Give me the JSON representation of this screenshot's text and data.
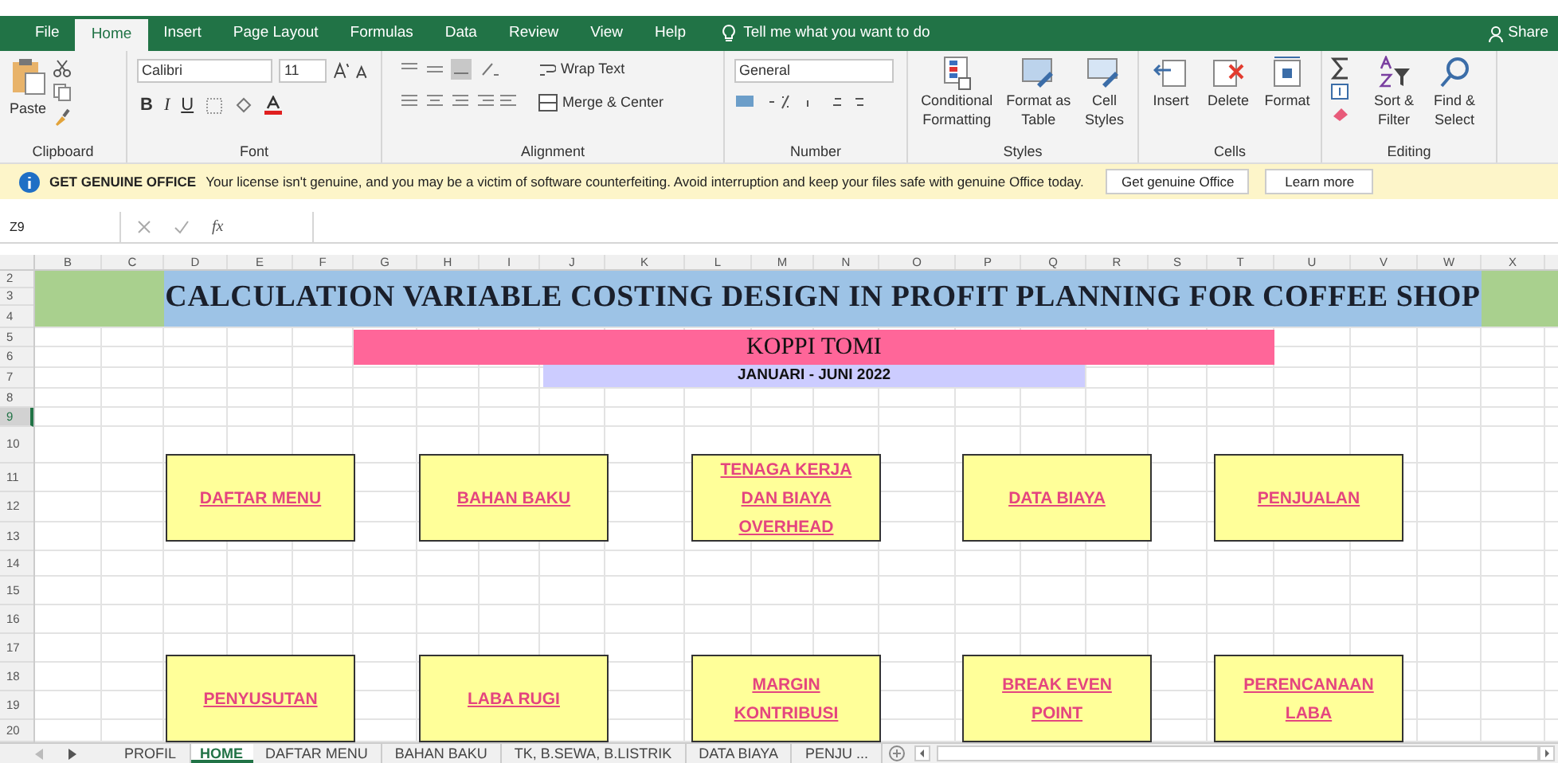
{
  "ribbon_tabs": [
    {
      "label": "File",
      "selected": false
    },
    {
      "label": "Home",
      "selected": true
    },
    {
      "label": "Insert",
      "selected": false
    },
    {
      "label": "Page Layout",
      "selected": false
    },
    {
      "label": "Formulas",
      "selected": false
    },
    {
      "label": "Data",
      "selected": false
    },
    {
      "label": "Review",
      "selected": false
    },
    {
      "label": "View",
      "selected": false
    },
    {
      "label": "Help",
      "selected": false
    }
  ],
  "tell_me": "Tell me what you want to do",
  "share": "Share",
  "ribbon": {
    "paste": "Paste",
    "font_name": "Calibri",
    "font_size": "11",
    "bold": "B",
    "italic": "I",
    "underline": "U",
    "wrap_text": "Wrap Text",
    "merge_center": "Merge & Center",
    "number_format": "General",
    "conditional_formatting": "Conditional Formatting",
    "format_as_table": "Format as Table",
    "cell_styles": "Cell Styles",
    "insert": "Insert",
    "delete": "Delete",
    "format": "Format",
    "sort_filter": "Sort & Filter",
    "find_select": "Find & Select",
    "groups": [
      "Clipboard",
      "Font",
      "Alignment",
      "Number",
      "Styles",
      "Cells",
      "Editing"
    ]
  },
  "notice": {
    "title": "GET GENUINE OFFICE",
    "message": "Your license isn't genuine, and you may be a victim of software counterfeiting. Avoid interruption and keep your files safe with genuine Office today.",
    "buttons": [
      "Get genuine Office",
      "Learn more"
    ]
  },
  "name_box": "Z9",
  "fx": "fx",
  "columns": [
    "B",
    "C",
    "D",
    "E",
    "F",
    "G",
    "H",
    "I",
    "J",
    "K",
    "L",
    "M",
    "N",
    "O",
    "P",
    "Q",
    "R",
    "S",
    "T",
    "U",
    "V",
    "W",
    "X"
  ],
  "rows": [
    {
      "label": "2",
      "selected": false
    },
    {
      "label": "3",
      "selected": false
    },
    {
      "label": "4",
      "selected": false
    },
    {
      "label": "5",
      "selected": false
    },
    {
      "label": "6",
      "selected": false
    },
    {
      "label": "7",
      "selected": false
    },
    {
      "label": "8",
      "selected": false
    },
    {
      "label": "9",
      "selected": true
    },
    {
      "label": "10",
      "selected": false
    },
    {
      "label": "11",
      "selected": false
    },
    {
      "label": "12",
      "selected": false
    },
    {
      "label": "13",
      "selected": false
    },
    {
      "label": "14",
      "selected": false
    },
    {
      "label": "15",
      "selected": false
    },
    {
      "label": "16",
      "selected": false
    },
    {
      "label": "17",
      "selected": false
    },
    {
      "label": "18",
      "selected": false
    },
    {
      "label": "19",
      "selected": false
    },
    {
      "label": "20",
      "selected": false
    }
  ],
  "title": "CALCULATION VARIABLE COSTING DESIGN IN PROFIT PLANNING FOR COFFEE SHOP",
  "shop_name": "KOPPI TOMI",
  "period": "JANUARI - JUNI 2022",
  "menu_buttons": [
    [
      "DAFTAR MENU",
      "BAHAN BAKU",
      "TENAGA KERJA DAN BIAYA OVERHEAD",
      "DATA BIAYA",
      "PENJUALAN"
    ],
    [
      "PENYUSUTAN",
      "LABA RUGI",
      "MARGIN KONTRIBUSI",
      "BREAK EVEN POINT",
      "PERENCANAAN LABA"
    ]
  ],
  "sheet_tabs": [
    {
      "label": "PROFIL",
      "selected": false
    },
    {
      "label": "HOME",
      "selected": true
    },
    {
      "label": "DAFTAR MENU",
      "selected": false
    },
    {
      "label": "BAHAN BAKU",
      "selected": false
    },
    {
      "label": "TK, B.SEWA, B.LISTRIK",
      "selected": false
    },
    {
      "label": "DATA BIAYA",
      "selected": false
    },
    {
      "label": "PENJU ...",
      "selected": false
    }
  ]
}
